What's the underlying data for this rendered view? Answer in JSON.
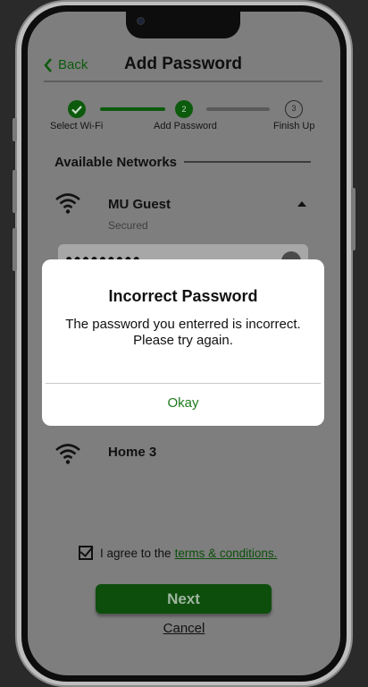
{
  "header": {
    "back_label": "Back",
    "title": "Add Password"
  },
  "stepper": {
    "steps": [
      {
        "label": "Select Wi-Fi",
        "state": "done"
      },
      {
        "label": "Add Password",
        "number": "2",
        "state": "active"
      },
      {
        "label": "Finish Up",
        "number": "3",
        "state": "pending"
      }
    ]
  },
  "networks": {
    "section_title": "Available Networks",
    "items": [
      {
        "name": "MU Guest",
        "status": "Secured",
        "icon": "wifi-icon",
        "expanded": true
      },
      {
        "name": "Home 3",
        "icon": "wifi-icon"
      }
    ],
    "password_mask": "●●●●●●●●●"
  },
  "agreement": {
    "text": "I agree to the",
    "link": "terms & conditions.",
    "checked": true
  },
  "actions": {
    "next_label": "Next",
    "cancel_label": "Cancel"
  },
  "dialog": {
    "title": "Incorrect Password",
    "message_line1": "The password you enterred is incorrect.",
    "message_line2": "Please try again.",
    "button_label": "Okay"
  },
  "colors": {
    "accent": "#0c5a0c",
    "dialog_button": "#1d7a1d",
    "overlay": "#7e7e7e"
  }
}
